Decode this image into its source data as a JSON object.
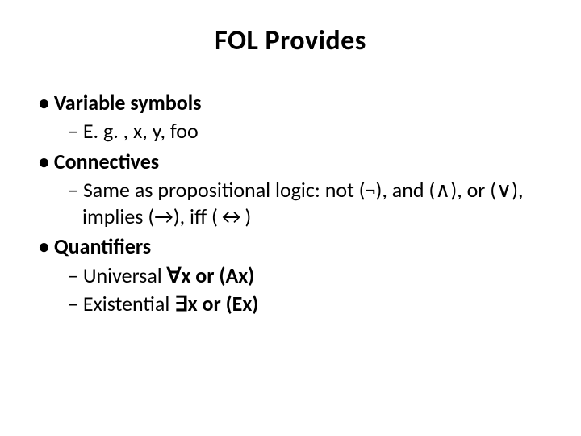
{
  "title": "FOL Provides",
  "b1": "Variable symbols",
  "b1s1": "E. g. , x, y, foo",
  "b2": "Connectives",
  "b2s1a": "Same as propositional logic: not (",
  "sym_not": "¬",
  "b2s1b": "), and (",
  "sym_and": "∧",
  "b2s1c": "), or (",
  "sym_or": "∨",
  "b2s1d": "), implies (",
  "sym_imp": "→",
  "b2s1e": "), iff (",
  "sym_iff": "↔",
  "b2s1f": ")",
  "b3": "Quantifiers",
  "b3s1a": "Universal ",
  "sym_forall": "∀",
  "b3s1b": "x or  (Ax)",
  "b3s2a": "Existential ",
  "sym_exists": "∃",
  "b3s2b": "x or (Ex)"
}
